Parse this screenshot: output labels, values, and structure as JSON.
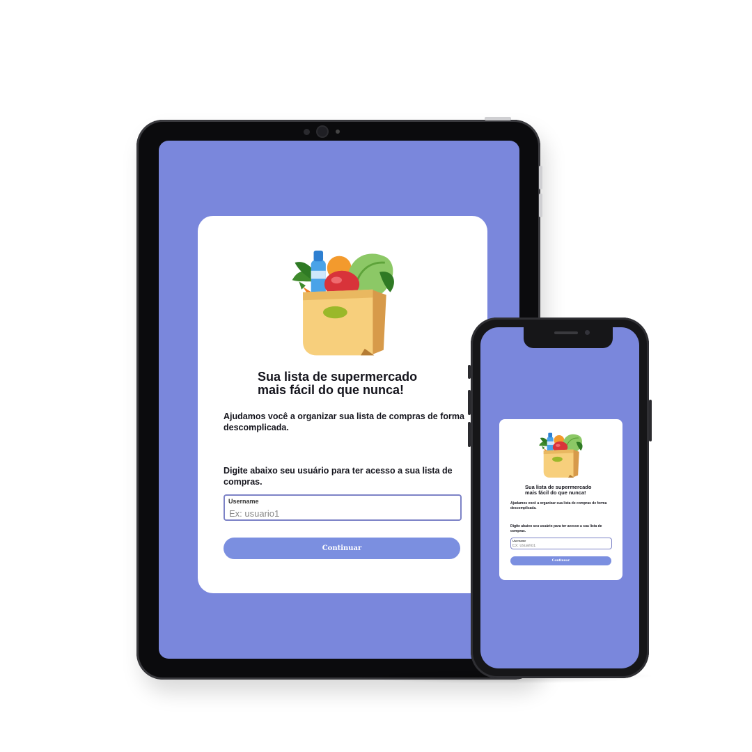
{
  "app": {
    "headline_line1": "Sua lista de supermercado",
    "headline_line2": "mais fácil do que nunca!",
    "description": "Ajudamos você a organizar sua lista de compras de forma descomplicada.",
    "instruction": "Digite abaixo seu usuário para ter acesso a sua lista de compras.",
    "input": {
      "label": "Username",
      "placeholder": "Ex: usuario1",
      "value": ""
    },
    "button_label": "Continuar",
    "illustration_icon": "grocery-bag-icon"
  },
  "colors": {
    "screen_background": "#7a87dc",
    "card_background": "#ffffff",
    "button_background": "#7b8fe0",
    "input_border": "#7c82c6",
    "device_frame": "#0b0b0d"
  }
}
